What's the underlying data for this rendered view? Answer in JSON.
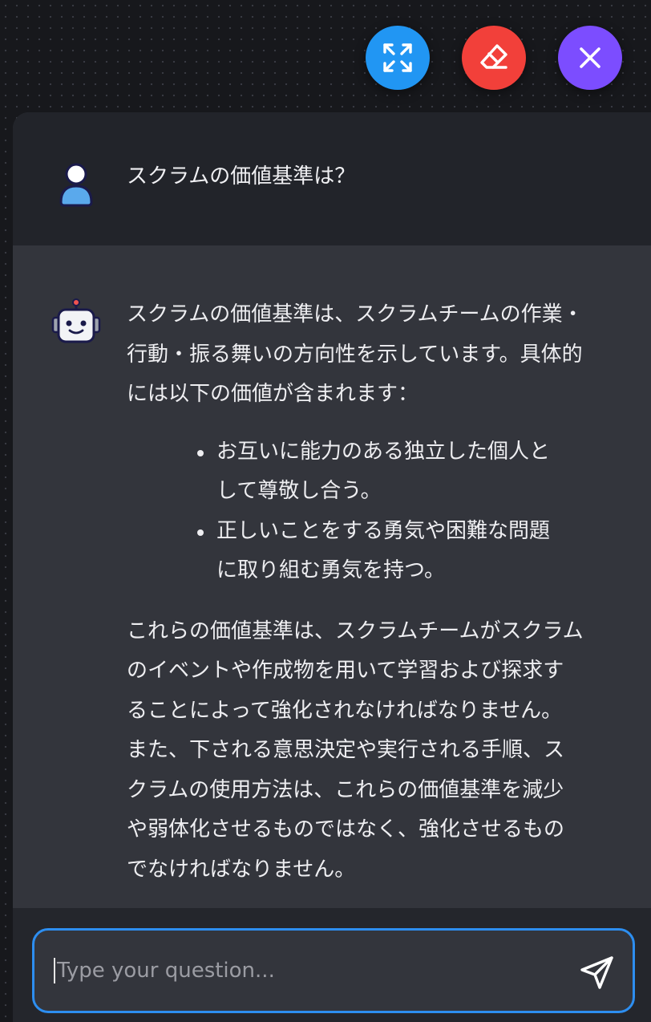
{
  "toolbar": {
    "expand_icon": "expand-arrows-icon",
    "clear_icon": "eraser-icon",
    "close_icon": "close-x-icon",
    "colors": {
      "expand": "#2196f3",
      "clear": "#f2403a",
      "close": "#7c4dff"
    }
  },
  "conversation": {
    "question": "スクラムの価値基準は？",
    "answer": {
      "intro_lines": [
        "スクラムの価値基準は、スクラムチームの作業・",
        "行動・振る舞いの方向性を示しています。具体的",
        "には以下の価値が含まれます："
      ],
      "bullets": [
        [
          "お互いに能力のある独立した個人と",
          "して尊敬し合う。"
        ],
        [
          "正しいことをする勇気や困難な問題",
          "に取り組む勇気を持つ。"
        ]
      ],
      "closing_lines": [
        "これらの価値基準は、スクラムチームがスクラム",
        "のイベントや作成物を用いて学習および探求す",
        "ることによって強化されなければなりません。",
        "また、下される意思決定や実行される手順、ス",
        "クラムの使用方法は、これらの価値基準を減少",
        "や弱体化させるものではなく、強化させるもの",
        "でなければなりません。"
      ]
    }
  },
  "input": {
    "placeholder": "Type your question...",
    "value": "",
    "send_icon": "send-plane-icon",
    "border_color": "#2d8ef0"
  }
}
